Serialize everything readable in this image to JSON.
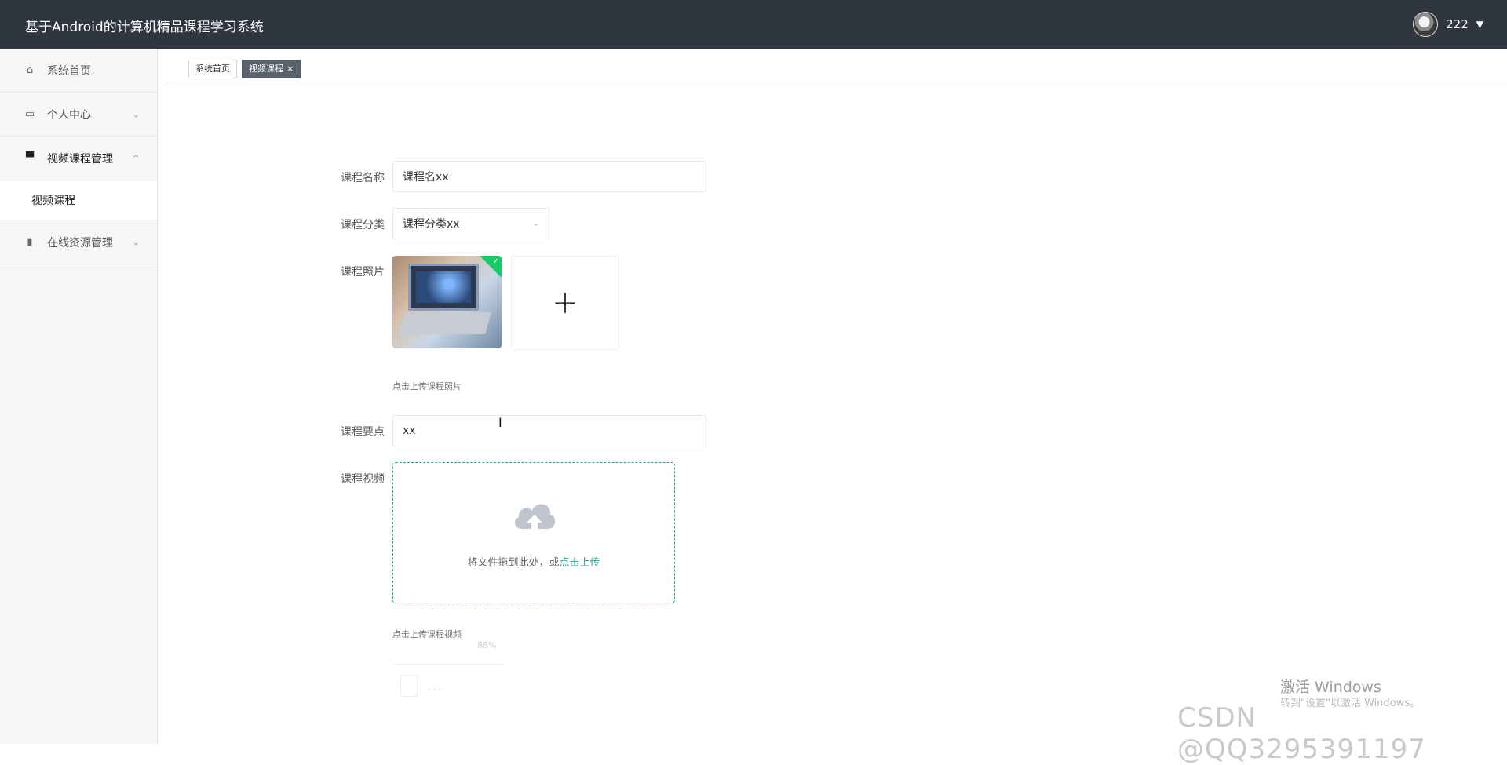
{
  "app": {
    "title": "基于Android的计算机精品课程学习系统"
  },
  "user": {
    "name": "222",
    "caret": "▼"
  },
  "sidebar": {
    "items": [
      {
        "label": "系统首页",
        "icon": "home-icon",
        "glyph": "⌂",
        "arrow": ""
      },
      {
        "label": "个人中心",
        "icon": "wallet-icon",
        "glyph": "▭",
        "arrow": "⌄"
      },
      {
        "label": "视频课程管理",
        "icon": "brush-icon",
        "glyph": "▀",
        "arrow": "^"
      },
      {
        "label": "在线资源管理",
        "icon": "clipboard-icon",
        "glyph": "▮",
        "arrow": "⌄"
      }
    ],
    "submenu": {
      "label": "视频课程"
    }
  },
  "tabs": [
    {
      "label": "系统首页"
    },
    {
      "label": "视频课程",
      "close": "×"
    }
  ],
  "form": {
    "course_name": {
      "label": "课程名称",
      "value": "课程名xx"
    },
    "category": {
      "label": "课程分类",
      "value": "课程分类xx",
      "arrow": "⌄"
    },
    "photo": {
      "label": "课程照片",
      "hint": "点击上传课程照片",
      "plus": "+"
    },
    "key_points": {
      "label": "课程要点",
      "value": "xx"
    },
    "video": {
      "label": "课程视频",
      "drag_text": "将文件拖到此处，或",
      "drag_link": "点击上传",
      "hint": "点击上传课程视频",
      "faint_number": "88%",
      "dots": "..."
    }
  },
  "watermark": {
    "activate": "激活 Windows",
    "activate_sub": "转到\"设置\"以激活 Windows。",
    "csdn": "CSDN @QQ3295391197"
  }
}
